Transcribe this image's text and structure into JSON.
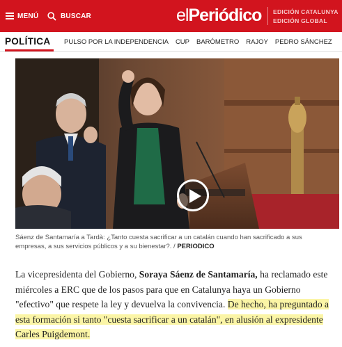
{
  "header": {
    "menu_label": "MENÚ",
    "search_label": "BUSCAR",
    "logo_prefix": "el",
    "logo_main": "Periódico",
    "editions": [
      "EDICIÓN CATALUNYA",
      "EDICIÓN GLOBAL"
    ],
    "brand_color": "#d2141e"
  },
  "section": {
    "title": "POLÍTICA",
    "links": [
      "PULSO POR LA INDEPENDENCIA",
      "CUP",
      "BARÓMETRO",
      "RAJOY",
      "PEDRO SÁNCHEZ"
    ]
  },
  "media": {
    "play_icon": "play-icon"
  },
  "caption": {
    "text": "Sáenz de Santamaría a Tardà: ¿Tanto cuesta sacrificar a un catalán cuando han sacrificado a sus empresas, a sus servicios públicos y a su bienestar?. / ",
    "credit": "PERIODICO"
  },
  "article": {
    "p1_a": "La vicepresidenta del Gobierno, ",
    "p1_b": "Soraya Sáenz de Santamaría,",
    "p1_c": " ha reclamado este miércoles a ERC que de los pasos para que en Catalunya haya un Gobierno \"efectivo\" que respete la ley y devuelva la convivencia. ",
    "p1_d": "De hecho, ha preguntado a esta formación si tanto \"cuesta sacrificar a un catalán\", en alusión al expresidente Carles Puigdemont."
  }
}
